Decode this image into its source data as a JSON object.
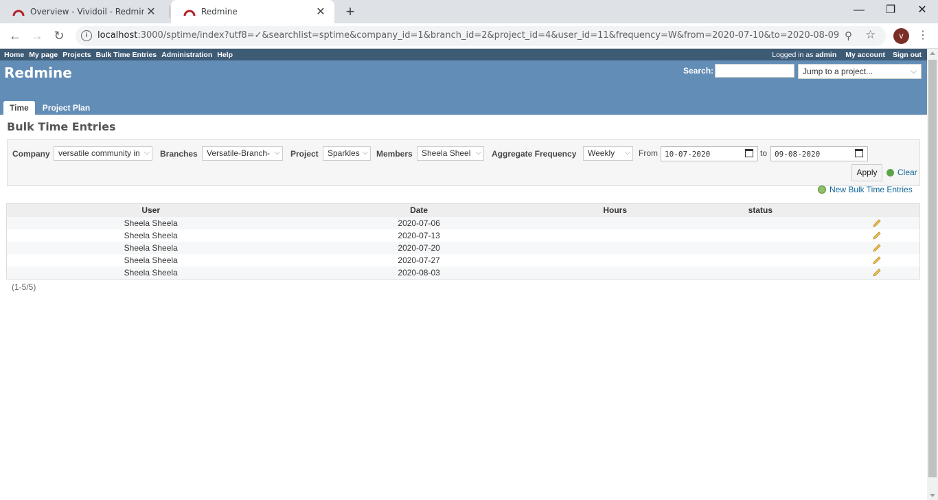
{
  "browser": {
    "tabs": [
      {
        "title": "Overview - Vividoil - Redmine",
        "active": false
      },
      {
        "title": "Redmine",
        "active": true
      }
    ],
    "url_host": "localhost",
    "url_rest": ":3000/sptime/index?utf8=✓&searchlist=sptime&company_id=1&branch_id=2&project_id=4&user_id=11&frequency=W&from=2020-07-10&to=2020-08-09",
    "avatar_letter": "v"
  },
  "topmenu": {
    "items": [
      "Home",
      "My page",
      "Projects",
      "Bulk Time Entries",
      "Administration",
      "Help"
    ],
    "logged_in_prefix": "Logged in as",
    "user": "admin",
    "my_account": "My account",
    "sign_out": "Sign out"
  },
  "header": {
    "title": "Redmine",
    "search_label": "Search:",
    "jump_placeholder": "Jump to a project...",
    "tabs": [
      "Time",
      "Project Plan"
    ]
  },
  "content": {
    "title": "Bulk Time Entries",
    "filters": {
      "company_label": "Company",
      "company_value": "versatile community in",
      "branches_label": "Branches",
      "branches_value": "Versatile-Branch-",
      "project_label": "Project",
      "project_value": "Sparkles",
      "members_label": "Members",
      "members_value": "Sheela Sheel",
      "frequency_label": "Aggregate Frequency",
      "frequency_value": "Weekly",
      "from_label": "From",
      "from_value": "10-07-2020",
      "to_label": "to",
      "to_value": "09-08-2020",
      "apply": "Apply",
      "clear": "Clear"
    },
    "new_entries": "New Bulk Time Entries",
    "table": {
      "headers": [
        "User",
        "Date",
        "Hours",
        "status"
      ],
      "rows": [
        {
          "user": "Sheela Sheela",
          "date": "2020-07-06",
          "hours": "",
          "status": ""
        },
        {
          "user": "Sheela Sheela",
          "date": "2020-07-13",
          "hours": "",
          "status": ""
        },
        {
          "user": "Sheela Sheela",
          "date": "2020-07-20",
          "hours": "",
          "status": ""
        },
        {
          "user": "Sheela Sheela",
          "date": "2020-07-27",
          "hours": "",
          "status": ""
        },
        {
          "user": "Sheela Sheela",
          "date": "2020-08-03",
          "hours": "",
          "status": ""
        }
      ]
    },
    "pager": "(1-5/5)"
  }
}
